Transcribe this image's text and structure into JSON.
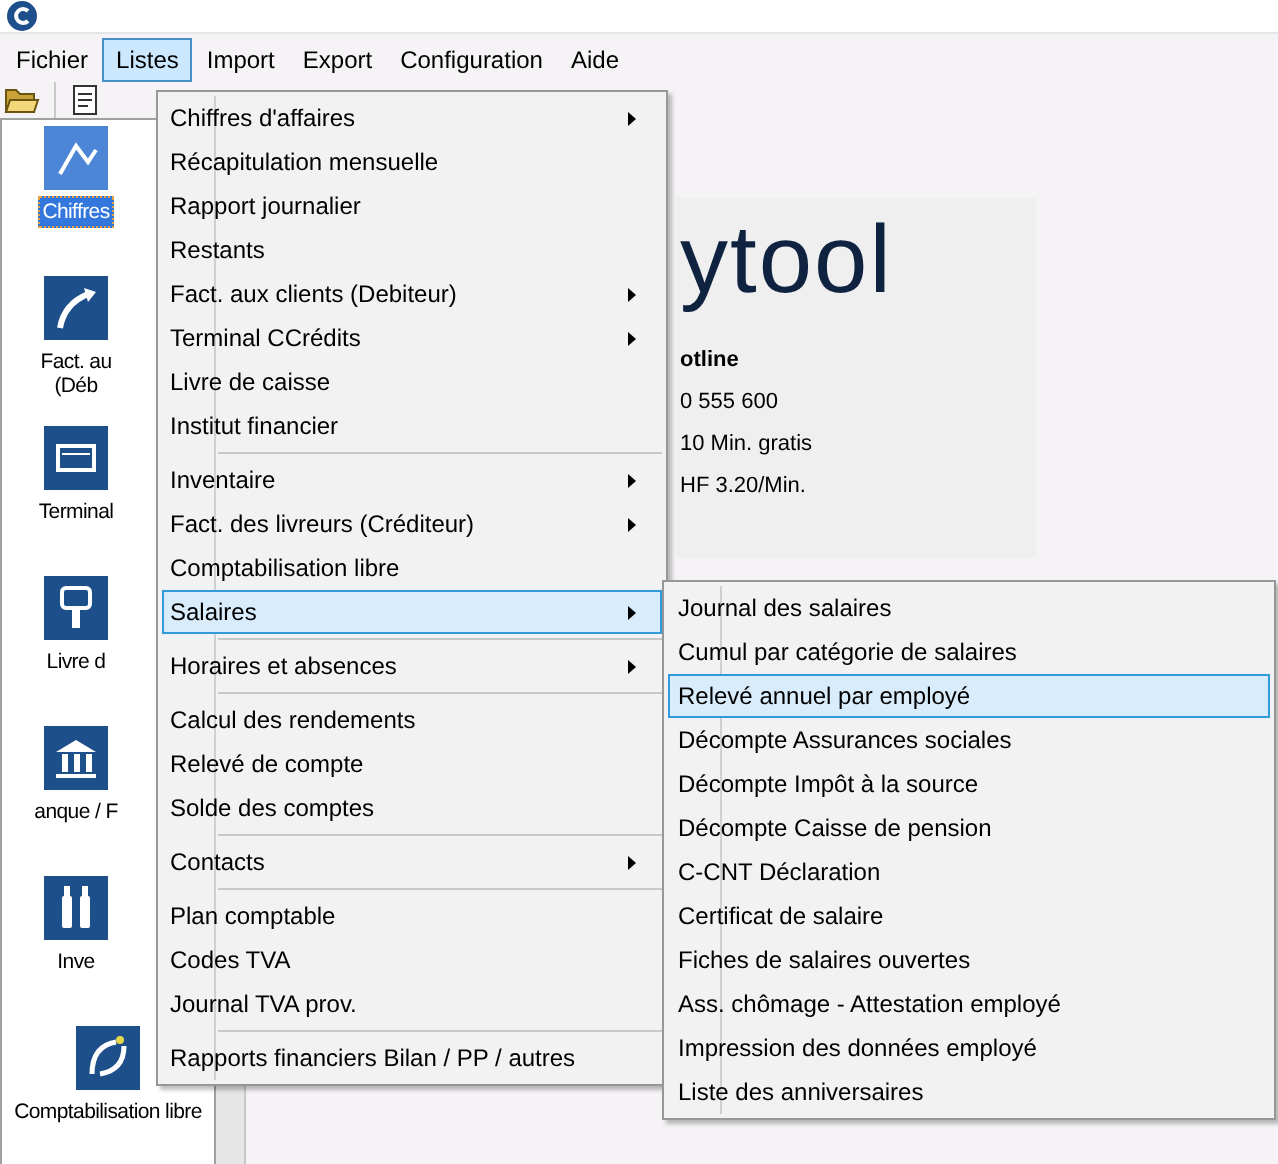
{
  "menubar": [
    {
      "label": "Fichier",
      "selected": false
    },
    {
      "label": "Listes",
      "selected": true
    },
    {
      "label": "Import",
      "selected": false
    },
    {
      "label": "Export",
      "selected": false
    },
    {
      "label": "Configuration",
      "selected": false
    },
    {
      "label": "Aide",
      "selected": false
    }
  ],
  "sidebar": {
    "items": [
      {
        "lines": [
          "Chiffres"
        ],
        "selected": true
      },
      {
        "lines": [
          "Fact. au",
          "(Déb"
        ],
        "selected": false
      },
      {
        "lines": [
          "Terminal"
        ],
        "selected": false
      },
      {
        "lines": [
          "Livre d"
        ],
        "selected": false
      },
      {
        "lines": [
          "anque / F"
        ],
        "selected": false
      },
      {
        "lines": [
          "Inve"
        ],
        "selected": false
      },
      {
        "lines": [
          "Comptabilisation libre"
        ],
        "selected": false
      }
    ]
  },
  "logo_panel": {
    "logo": "ytool",
    "hotline": [
      "otline",
      "0 555 600",
      "10 Min. gratis",
      "HF 3.20/Min."
    ]
  },
  "menu": {
    "groups": [
      [
        {
          "label": "Chiffres d'affaires",
          "submenu": true,
          "selected": false
        },
        {
          "label": "Récapitulation mensuelle",
          "submenu": false,
          "selected": false
        },
        {
          "label": "Rapport journalier",
          "submenu": false,
          "selected": false
        },
        {
          "label": "Restants",
          "submenu": false,
          "selected": false
        },
        {
          "label": "Fact. aux clients (Debiteur)",
          "submenu": true,
          "selected": false
        },
        {
          "label": "Terminal CCrédits",
          "submenu": true,
          "selected": false
        },
        {
          "label": "Livre de caisse",
          "submenu": false,
          "selected": false
        },
        {
          "label": "Institut financier",
          "submenu": false,
          "selected": false
        }
      ],
      [
        {
          "label": "Inventaire",
          "submenu": true,
          "selected": false
        },
        {
          "label": "Fact. des livreurs (Créditeur)",
          "submenu": true,
          "selected": false
        },
        {
          "label": "Comptabilisation libre",
          "submenu": false,
          "selected": false
        },
        {
          "label": "Salaires",
          "submenu": true,
          "selected": true
        }
      ],
      [
        {
          "label": "Horaires et absences",
          "submenu": true,
          "selected": false
        }
      ],
      [
        {
          "label": "Calcul des rendements",
          "submenu": false,
          "selected": false
        },
        {
          "label": "Relevé de compte",
          "submenu": false,
          "selected": false
        },
        {
          "label": "Solde des comptes",
          "submenu": false,
          "selected": false
        }
      ],
      [
        {
          "label": "Contacts",
          "submenu": true,
          "selected": false
        }
      ],
      [
        {
          "label": "Plan comptable",
          "submenu": false,
          "selected": false
        },
        {
          "label": "Codes TVA",
          "submenu": false,
          "selected": false
        },
        {
          "label": "Journal TVA prov.",
          "submenu": false,
          "selected": false
        }
      ],
      [
        {
          "label": "Rapports financiers Bilan / PP / autres",
          "submenu": false,
          "selected": false
        }
      ]
    ]
  },
  "submenu": {
    "items": [
      {
        "label": "Journal des salaires",
        "selected": false
      },
      {
        "label": "Cumul par catégorie de salaires",
        "selected": false
      },
      {
        "label": "Relevé annuel par employé",
        "selected": true
      },
      {
        "label": "Décompte Assurances sociales",
        "selected": false
      },
      {
        "label": "Décompte Impôt à la source",
        "selected": false
      },
      {
        "label": "Décompte Caisse de pension",
        "selected": false
      },
      {
        "label": "C-CNT Déclaration",
        "selected": false
      },
      {
        "label": "Certificat de salaire",
        "selected": false
      },
      {
        "label": "Fiches de salaires ouvertes",
        "selected": false
      },
      {
        "label": "Ass. chômage - Attestation employé",
        "selected": false
      },
      {
        "label": "Impression des données employé",
        "selected": false
      },
      {
        "label": "Liste des anniversaires",
        "selected": false
      }
    ]
  }
}
